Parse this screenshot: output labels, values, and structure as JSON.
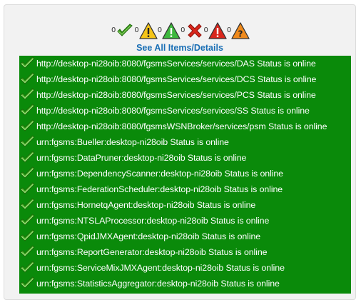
{
  "summary": {
    "items": [
      {
        "count": "0",
        "icon": "green-check-icon"
      },
      {
        "count": "0",
        "icon": "yellow-warning-icon"
      },
      {
        "count": "0",
        "icon": "green-warning-icon"
      },
      {
        "count": "0",
        "icon": "red-x-icon"
      },
      {
        "count": "0",
        "icon": "red-warning-icon"
      },
      {
        "count": "0",
        "icon": "orange-question-icon"
      }
    ]
  },
  "see_all_link": "See All Items/Details",
  "status_rows": [
    {
      "text": "http://desktop-ni28oib:8080/fgsmsServices/services/DAS Status is online",
      "icon": "green-check-icon"
    },
    {
      "text": "http://desktop-ni28oib:8080/fgsmsServices/services/DCS Status is online",
      "icon": "green-check-icon"
    },
    {
      "text": "http://desktop-ni28oib:8080/fgsmsServices/services/PCS Status is online",
      "icon": "green-check-icon"
    },
    {
      "text": "http://desktop-ni28oib:8080/fgsmsServices/services/SS Status is online",
      "icon": "green-check-icon"
    },
    {
      "text": "http://desktop-ni28oib:8080/fgsmsWSNBroker/services/psm Status is online",
      "icon": "green-check-icon"
    },
    {
      "text": "urn:fgsms:Bueller:desktop-ni28oib Status is online",
      "icon": "green-check-icon"
    },
    {
      "text": "urn:fgsms:DataPruner:desktop-ni28oib Status is online",
      "icon": "green-check-icon"
    },
    {
      "text": "urn:fgsms:DependencyScanner:desktop-ni28oib Status is online",
      "icon": "green-check-icon"
    },
    {
      "text": "urn:fgsms:FederationScheduler:desktop-ni28oib Status is online",
      "icon": "green-check-icon"
    },
    {
      "text": "urn:fgsms:HornetqAgent:desktop-ni28oib Status is online",
      "icon": "green-check-icon"
    },
    {
      "text": "urn:fgsms:NTSLAProcessor:desktop-ni28oib Status is online",
      "icon": "green-check-icon"
    },
    {
      "text": "urn:fgsms:QpidJMXAgent:desktop-ni28oib Status is online",
      "icon": "green-check-icon"
    },
    {
      "text": "urn:fgsms:ReportGenerator:desktop-ni28oib Status is online",
      "icon": "green-check-icon"
    },
    {
      "text": "urn:fgsms:ServiceMixJMXAgent:desktop-ni28oib Status is online",
      "icon": "green-check-icon"
    },
    {
      "text": "urn:fgsms:StatisticsAggregator:desktop-ni28oib Status is online",
      "icon": "green-check-icon"
    }
  ],
  "colors": {
    "list_background": "#0a8a0a",
    "link": "#1a6fb5",
    "panel_background": "#f2f2f2"
  }
}
